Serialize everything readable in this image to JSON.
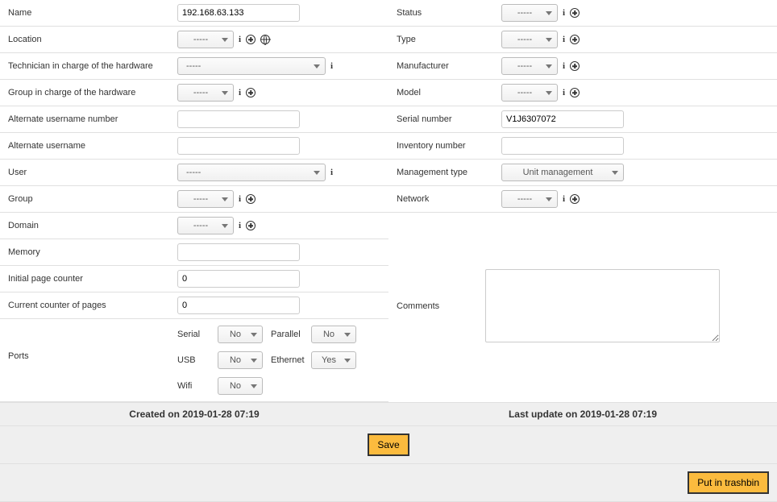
{
  "left": {
    "name": {
      "label": "Name",
      "value": "192.168.63.133"
    },
    "location": {
      "label": "Location",
      "value": "-----"
    },
    "tech_hw": {
      "label": "Technician in charge of the hardware",
      "value": "-----"
    },
    "group_hw": {
      "label": "Group in charge of the hardware",
      "value": "-----"
    },
    "alt_user_num": {
      "label": "Alternate username number",
      "value": ""
    },
    "alt_user": {
      "label": "Alternate username",
      "value": ""
    },
    "user": {
      "label": "User",
      "value": "-----"
    },
    "group": {
      "label": "Group",
      "value": "-----"
    },
    "domain": {
      "label": "Domain",
      "value": "-----"
    },
    "memory": {
      "label": "Memory",
      "value": ""
    },
    "init_page": {
      "label": "Initial page counter",
      "value": "0"
    },
    "cur_page": {
      "label": "Current counter of pages",
      "value": "0"
    },
    "ports": {
      "label": "Ports",
      "serial": {
        "label": "Serial",
        "value": "No"
      },
      "parallel": {
        "label": "Parallel",
        "value": "No"
      },
      "usb": {
        "label": "USB",
        "value": "No"
      },
      "ethernet": {
        "label": "Ethernet",
        "value": "Yes"
      },
      "wifi": {
        "label": "Wifi",
        "value": "No"
      }
    }
  },
  "right": {
    "status": {
      "label": "Status",
      "value": "-----"
    },
    "type": {
      "label": "Type",
      "value": "-----"
    },
    "manufacturer": {
      "label": "Manufacturer",
      "value": "-----"
    },
    "model": {
      "label": "Model",
      "value": "-----"
    },
    "serial_num": {
      "label": "Serial number",
      "value": "V1J6307072"
    },
    "inv_num": {
      "label": "Inventory number",
      "value": ""
    },
    "mgmt_type": {
      "label": "Management type",
      "value": "Unit management"
    },
    "network": {
      "label": "Network",
      "value": "-----"
    },
    "comments": {
      "label": "Comments",
      "value": ""
    }
  },
  "footer": {
    "created": "Created on 2019-01-28 07:19",
    "updated": "Last update on 2019-01-28 07:19"
  },
  "actions": {
    "save": "Save",
    "trash": "Put in trashbin"
  }
}
